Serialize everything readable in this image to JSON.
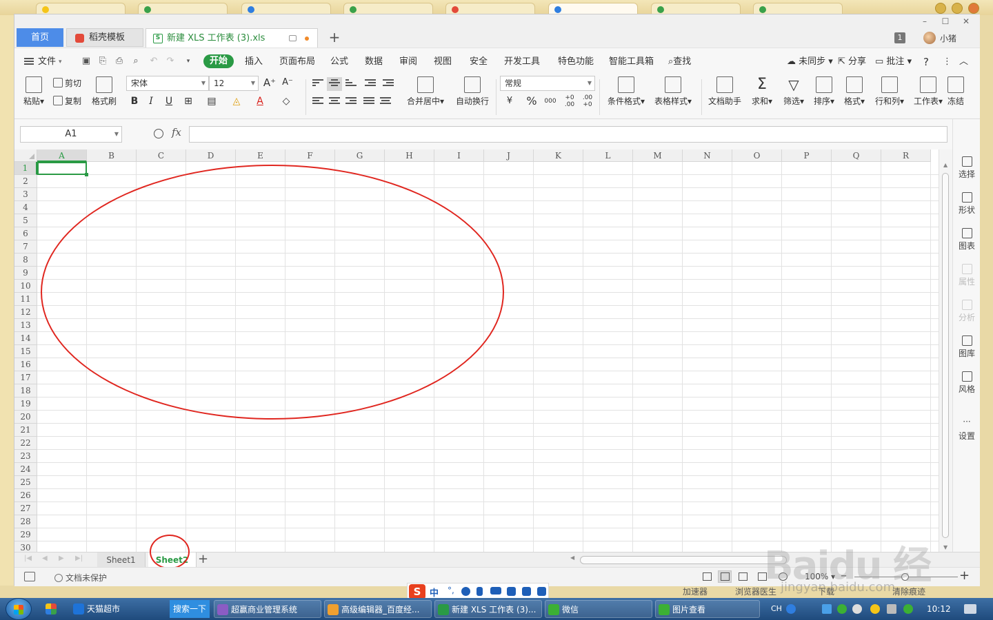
{
  "titlebar": {
    "tab_home": "首页",
    "tab_template": "稻壳模板",
    "tab_file": "新建 XLS 工作表 (3).xls",
    "file_icon": "S",
    "page_badge": "1",
    "username": "小猪"
  },
  "menubar": {
    "file_label": "文件",
    "items": [
      "开始",
      "插入",
      "页面布局",
      "公式",
      "数据",
      "审阅",
      "视图",
      "安全",
      "开发工具",
      "特色功能",
      "智能工具箱"
    ],
    "active_index": 0,
    "search": "查找",
    "sync": "未同步",
    "share": "分享",
    "comment": "批注",
    "help": "?"
  },
  "ribbon": {
    "paste": "粘贴",
    "cut": "剪切",
    "copy": "复制",
    "format_painter": "格式刷",
    "font_name": "宋体",
    "font_size": "12",
    "bold": "B",
    "italic": "I",
    "underline": "U",
    "merge_center": "合并居中",
    "wrap_text": "自动换行",
    "number_format": "常规",
    "currency": "¥",
    "percent": "%",
    "thousands": "000",
    "inc_decimal": "+0 .00",
    "dec_decimal": ".00 +0",
    "conditional_format": "条件格式",
    "table_style": "表格样式",
    "doc_assistant": "文档助手",
    "sum": "求和",
    "filter": "筛选",
    "sort": "排序",
    "format": "格式",
    "row_col": "行和列",
    "worksheet": "工作表",
    "freeze": "冻结"
  },
  "formulabar": {
    "name_box": "A1",
    "fx": "fx",
    "formula": ""
  },
  "grid": {
    "columns": [
      "A",
      "B",
      "C",
      "D",
      "E",
      "F",
      "G",
      "H",
      "I",
      "J",
      "K",
      "L",
      "M",
      "N",
      "O",
      "P",
      "Q",
      "R"
    ],
    "rows": [
      "1",
      "2",
      "3",
      "4",
      "5",
      "6",
      "7",
      "8",
      "9",
      "10",
      "11",
      "12",
      "13",
      "14",
      "15",
      "16",
      "17",
      "18",
      "19",
      "20",
      "21",
      "22",
      "23",
      "24",
      "25",
      "26",
      "27",
      "28",
      "29",
      "30"
    ],
    "active_cell": "A1"
  },
  "right_panel": {
    "items": [
      {
        "label": "选择",
        "enabled": true
      },
      {
        "label": "形状",
        "enabled": true
      },
      {
        "label": "图表",
        "enabled": true
      },
      {
        "label": "属性",
        "enabled": false
      },
      {
        "label": "分析",
        "enabled": false
      },
      {
        "label": "图库",
        "enabled": true
      },
      {
        "label": "风格",
        "enabled": true
      },
      {
        "label": "设置",
        "enabled": true
      }
    ]
  },
  "sheets": {
    "tabs": [
      "Sheet1",
      "Sheet2"
    ],
    "active_index": 1
  },
  "statusbar": {
    "protection": "文档未保护",
    "zoom": "100%"
  },
  "ime": {
    "logo": "S",
    "mode": "中"
  },
  "webbar": {
    "accelerator": "加速器",
    "browser_doctor": "浏览器医生",
    "download": "下载",
    "clean": "清除痕迹"
  },
  "taskbar": {
    "items": [
      {
        "label": "天猫超市",
        "color": "#1e73d8"
      },
      {
        "label": "超赢商业管理系统",
        "color": "#8b5cc4"
      },
      {
        "label": "高级编辑器_百度经...",
        "color": "#f0a030"
      },
      {
        "label": "新建 XLS 工作表 (3)...",
        "color": "#2a9a45"
      },
      {
        "label": "微信",
        "color": "#3cb034"
      },
      {
        "label": "图片查看",
        "color": "#3cb034"
      }
    ],
    "search_button": "搜索一下",
    "lang": "CH",
    "clock": "10:12"
  },
  "watermark": {
    "brand": "Baidu 经验",
    "url": "jingyan.baidu.com"
  }
}
